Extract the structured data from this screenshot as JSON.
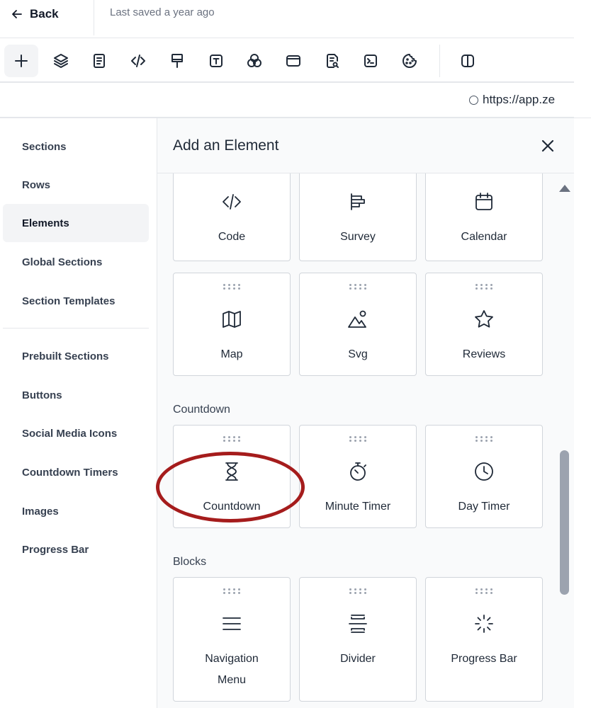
{
  "topbar": {
    "back_label": "Back",
    "saved_text": "Last saved a year ago"
  },
  "toolbar": {
    "tools": [
      "plus-icon",
      "layers-icon",
      "page-icon",
      "code-icon",
      "brush-icon",
      "text-icon",
      "circles-icon",
      "window-icon",
      "search-doc-icon",
      "terminal-icon",
      "cookie-icon",
      "split-view-icon"
    ]
  },
  "urlbar": {
    "url": "https://app.ze"
  },
  "sidebar": {
    "items": [
      {
        "label": "Sections"
      },
      {
        "label": "Rows"
      },
      {
        "label": "Elements"
      },
      {
        "label": "Global Sections"
      },
      {
        "label": "Section Templates"
      },
      {
        "label": "Prebuilt Sections"
      },
      {
        "label": "Buttons"
      },
      {
        "label": "Social Media Icons"
      },
      {
        "label": "Countdown Timers"
      },
      {
        "label": "Images"
      },
      {
        "label": "Progress Bar"
      }
    ],
    "active": "Elements"
  },
  "panel": {
    "title": "Add an Element",
    "groups": [
      {
        "label": "",
        "cards": [
          {
            "label": "Code",
            "icon": "code-icon"
          },
          {
            "label": "Survey",
            "icon": "survey-icon"
          },
          {
            "label": "Calendar",
            "icon": "calendar-icon"
          },
          {
            "label": "Map",
            "icon": "map-icon"
          },
          {
            "label": "Svg",
            "icon": "svg-icon"
          },
          {
            "label": "Reviews",
            "icon": "star-icon"
          }
        ]
      },
      {
        "label": "Countdown",
        "cards": [
          {
            "label": "Countdown",
            "icon": "hourglass-icon"
          },
          {
            "label": "Minute Timer",
            "icon": "stopwatch-icon"
          },
          {
            "label": "Day Timer",
            "icon": "clock-icon"
          }
        ]
      },
      {
        "label": "Blocks",
        "cards": [
          {
            "label": "Navigation\nMenu",
            "icon": "menu-icon"
          },
          {
            "label": "Divider",
            "icon": "divider-icon"
          },
          {
            "label": "Progress Bar",
            "icon": "loader-icon"
          }
        ]
      }
    ]
  },
  "colors": {
    "highlight": "#a51c1c",
    "active_bg": "#f3f4f6"
  }
}
